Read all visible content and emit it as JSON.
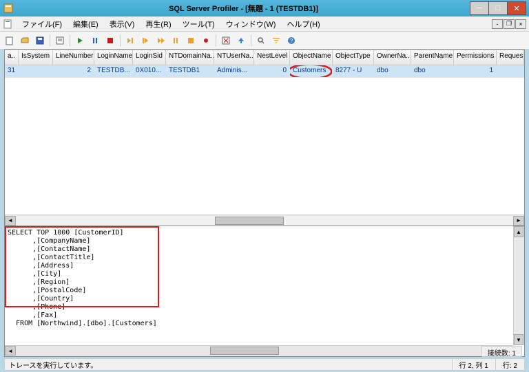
{
  "window": {
    "title": "SQL Server Profiler - [無題 - 1 (TESTDB1)]"
  },
  "menu": {
    "file": "ファイル(F)",
    "edit": "編集(E)",
    "view": "表示(V)",
    "replay": "再生(R)",
    "tools": "ツール(T)",
    "window": "ウィンドウ(W)",
    "help": "ヘルプ(H)"
  },
  "grid": {
    "columns": [
      "a..",
      "IsSystem",
      "LineNumber",
      "LoginName",
      "LoginSid",
      "NTDomainNa..",
      "NTUserNa..",
      "NestLevel",
      "ObjectName",
      "ObjectType",
      "OwnerNa..",
      "ParentName",
      "Permissions",
      "Reques"
    ],
    "row": {
      "a": "31",
      "is_system": "",
      "line_number": "2",
      "login_name": "TESTDB...",
      "login_sid": "0X010...",
      "nt_domain": "TESTDB1",
      "nt_user": "Adminis...",
      "nest_level": "0",
      "object_name": "Customers",
      "object_type": "8277 - U",
      "owner": "dbo",
      "parent": "dbo",
      "permissions": "1",
      "reques": ""
    }
  },
  "sql": "SELECT TOP 1000 [CustomerID]\n      ,[CompanyName]\n      ,[ContactName]\n      ,[ContactTitle]\n      ,[Address]\n      ,[City]\n      ,[Region]\n      ,[PostalCode]\n      ,[Country]\n      ,[Phone]\n      ,[Fax]\n  FROM [Northwind].[dbo].[Customers]",
  "status": {
    "message": "トレースを実行しています。",
    "position": "行 2, 列 1",
    "rows": "行: 2",
    "connections": "接続数: 1"
  }
}
